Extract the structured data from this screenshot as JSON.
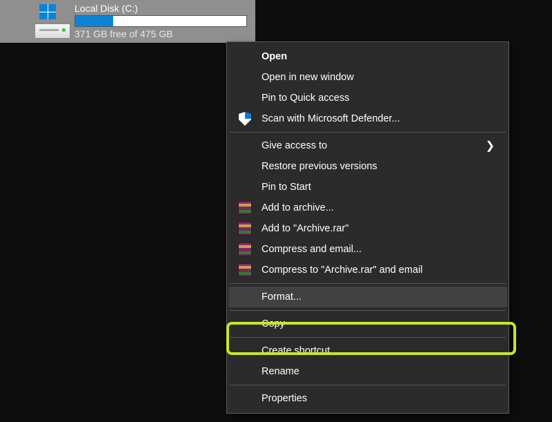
{
  "drive": {
    "name": "Local Disk (C:)",
    "free_text": "371 GB free of 475 GB",
    "used_percent": 22
  },
  "menu": {
    "open": "Open",
    "open_new_window": "Open in new window",
    "pin_quick_access": "Pin to Quick access",
    "scan_defender": "Scan with Microsoft Defender...",
    "give_access": "Give access to",
    "restore_versions": "Restore previous versions",
    "pin_start": "Pin to Start",
    "add_archive": "Add to archive...",
    "add_archive_rar": "Add to \"Archive.rar\"",
    "compress_email": "Compress and email...",
    "compress_rar_email": "Compress to \"Archive.rar\" and email",
    "format": "Format...",
    "copy": "Copy",
    "create_shortcut": "Create shortcut",
    "rename": "Rename",
    "properties": "Properties"
  }
}
